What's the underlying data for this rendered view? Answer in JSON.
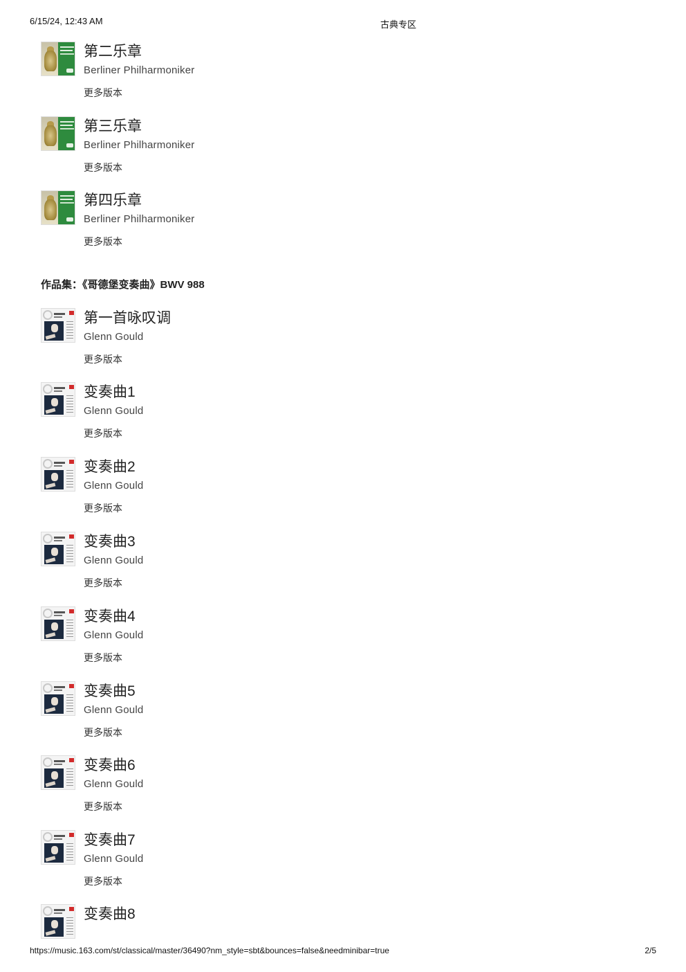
{
  "header": {
    "datetime": "6/15/24, 12:43 AM",
    "title": "古典专区"
  },
  "footer": {
    "url": "https://music.163.com/st/classical/master/36490?nm_style=sbt&bounces=false&needminibar=true",
    "page": "2/5"
  },
  "tracks_top": [
    {
      "title": "第二乐章",
      "artist": "Berliner Philharmoniker",
      "more": "更多版本",
      "cover": "berliner-album-cover"
    },
    {
      "title": "第三乐章",
      "artist": "Berliner Philharmoniker",
      "more": "更多版本",
      "cover": "berliner-album-cover"
    },
    {
      "title": "第四乐章",
      "artist": "Berliner Philharmoniker",
      "more": "更多版本",
      "cover": "berliner-album-cover"
    }
  ],
  "section": {
    "title": "作品集：《哥德堡变奏曲》BWV 988"
  },
  "tracks_goldberg": [
    {
      "title": "第一首咏叹调",
      "artist": "Glenn Gould",
      "more": "更多版本",
      "cover": "glenn-gould-album-cover"
    },
    {
      "title": "变奏曲1",
      "artist": "Glenn Gould",
      "more": "更多版本",
      "cover": "glenn-gould-album-cover"
    },
    {
      "title": "变奏曲2",
      "artist": "Glenn Gould",
      "more": "更多版本",
      "cover": "glenn-gould-album-cover"
    },
    {
      "title": "变奏曲3",
      "artist": "Glenn Gould",
      "more": "更多版本",
      "cover": "glenn-gould-album-cover"
    },
    {
      "title": "变奏曲4",
      "artist": "Glenn Gould",
      "more": "更多版本",
      "cover": "glenn-gould-album-cover"
    },
    {
      "title": "变奏曲5",
      "artist": "Glenn Gould",
      "more": "更多版本",
      "cover": "glenn-gould-album-cover"
    },
    {
      "title": "变奏曲6",
      "artist": "Glenn Gould",
      "more": "更多版本",
      "cover": "glenn-gould-album-cover"
    },
    {
      "title": "变奏曲7",
      "artist": "Glenn Gould",
      "more": "更多版本",
      "cover": "glenn-gould-album-cover"
    },
    {
      "title": "变奏曲8",
      "cover": "glenn-gould-album-cover"
    }
  ]
}
